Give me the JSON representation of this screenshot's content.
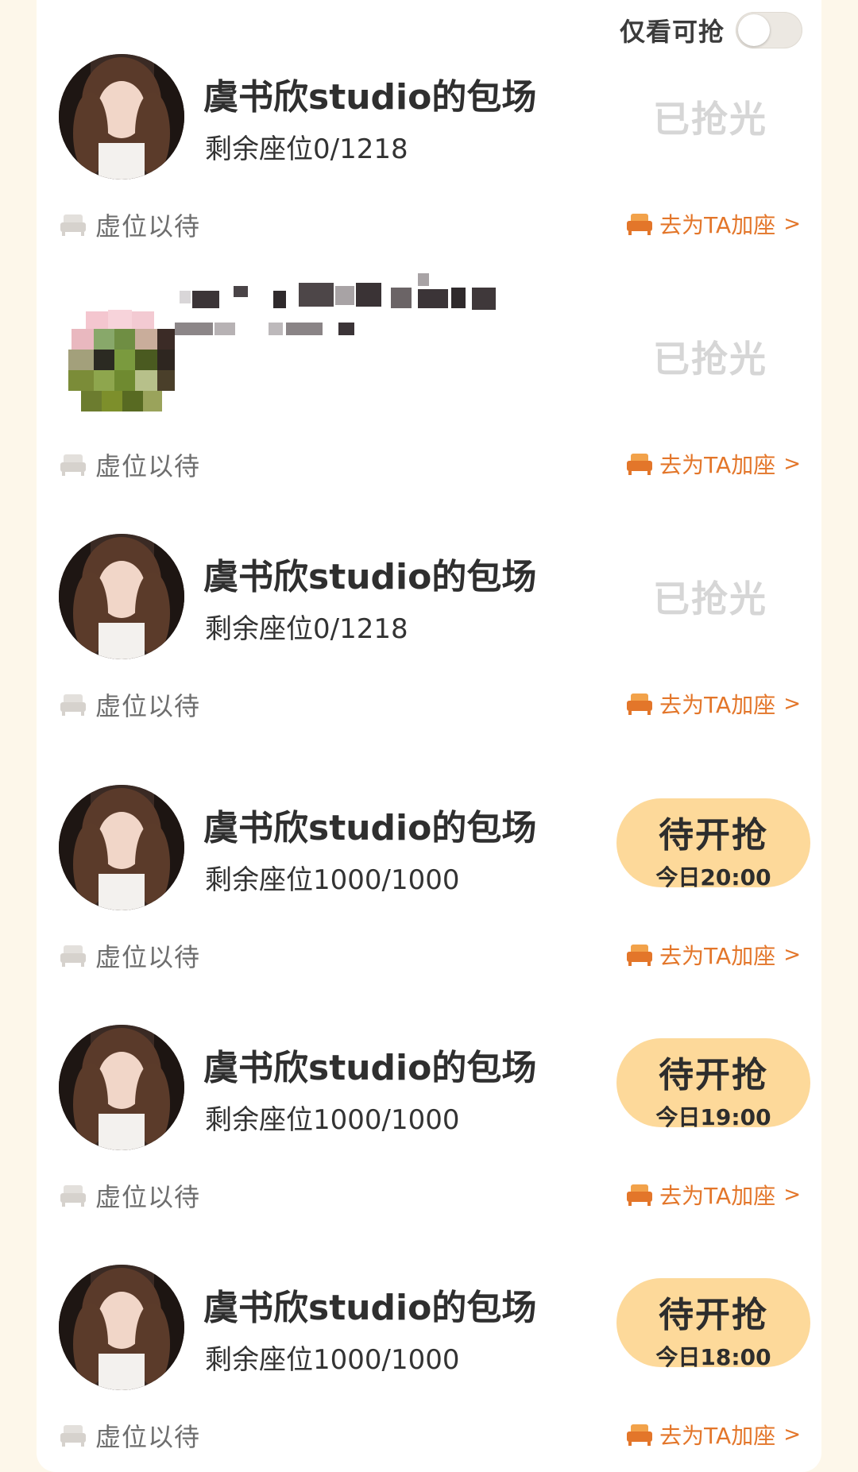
{
  "filter": {
    "label": "仅看可抢",
    "enabled": false
  },
  "items": [
    {
      "title": "虞书欣studio的包场",
      "seats": "剩余座位0/1218",
      "status": "soldout",
      "status_label": "已抢光",
      "pill_time": "",
      "wait_label": "虚位以待",
      "add_label": "去为TA加座",
      "chevron": ">"
    },
    {
      "title": "",
      "seats": "",
      "status": "soldout",
      "status_label": "已抢光",
      "pill_time": "",
      "wait_label": "虚位以待",
      "add_label": "去为TA加座",
      "chevron": ">"
    },
    {
      "title": "虞书欣studio的包场",
      "seats": "剩余座位0/1218",
      "status": "soldout",
      "status_label": "已抢光",
      "pill_time": "",
      "wait_label": "虚位以待",
      "add_label": "去为TA加座",
      "chevron": ">"
    },
    {
      "title": "虞书欣studio的包场",
      "seats": "剩余座位1000/1000",
      "status": "pending",
      "status_label": "待开抢",
      "pill_time": "今日20:00",
      "wait_label": "虚位以待",
      "add_label": "去为TA加座",
      "chevron": ">"
    },
    {
      "title": "虞书欣studio的包场",
      "seats": "剩余座位1000/1000",
      "status": "pending",
      "status_label": "待开抢",
      "pill_time": "今日19:00",
      "wait_label": "虚位以待",
      "add_label": "去为TA加座",
      "chevron": ">"
    },
    {
      "title": "虞书欣studio的包场",
      "seats": "剩余座位1000/1000",
      "status": "pending",
      "status_label": "待开抢",
      "pill_time": "今日18:00",
      "wait_label": "虚位以待",
      "add_label": "去为TA加座",
      "chevron": ">"
    }
  ],
  "colors": {
    "page_bg": "#fdf7ea",
    "panel_bg": "#ffffff",
    "accent_orange": "#e3762a",
    "pill_bg": "#fdd99a",
    "soldout_text": "#d6d6d6"
  },
  "icons": {
    "seat_gray": "seat-icon",
    "seat_orange": "seat-icon",
    "toggle": "toggle-switch"
  }
}
